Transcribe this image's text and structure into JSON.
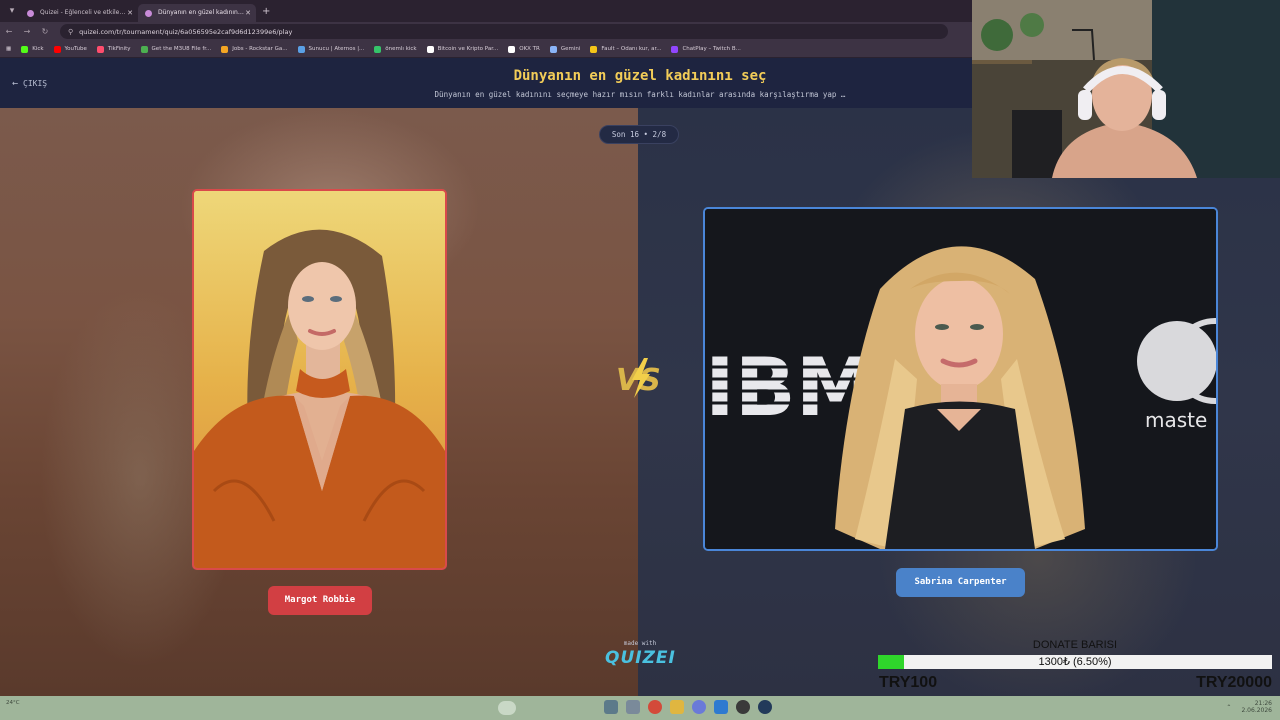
{
  "browser": {
    "tabs": [
      {
        "label": "Quizei - Eğlenceli ve etkileşimli",
        "active": false
      },
      {
        "label": "Dünyanın en güzel kadınını seç",
        "active": true
      }
    ],
    "url": "quizei.com/tr/tournament/quiz/6a056595e2caf9d6d12399e6/play",
    "bookmarks": [
      {
        "label": "Kick",
        "color": "#53fc18"
      },
      {
        "label": "YouTube",
        "color": "#ff0000"
      },
      {
        "label": "TikFinity",
        "color": "#ff4d6d"
      },
      {
        "label": "Get the M3U8 File fr...",
        "color": "#4caf50"
      },
      {
        "label": "Jobs - Rockstar Ga...",
        "color": "#f5a623"
      },
      {
        "label": "Sunucu | Aternos |...",
        "color": "#5aa0e6"
      },
      {
        "label": "önemlı kick",
        "color": "#35c46a"
      },
      {
        "label": "Bitcoin ve Kripto Par...",
        "color": "#ffffff"
      },
      {
        "label": "OKX TR",
        "color": "#ffffff"
      },
      {
        "label": "Gemini",
        "color": "#8ab4f8"
      },
      {
        "label": "Fault – Odanı kur, ar...",
        "color": "#f5c518"
      },
      {
        "label": "ChatPlay – Twitch B...",
        "color": "#9146ff"
      }
    ]
  },
  "header": {
    "exit_label": "ÇIKIŞ",
    "title": "Dünyanın en güzel kadınını seç",
    "description": "Dünyanın en güzel kadınını seçmeye hazır mısın farklı kadınlar arasında karşılaştırma yap …"
  },
  "round": {
    "label": "Son 16 • 2/8"
  },
  "contestants": {
    "left": {
      "name": "Margot Robbie",
      "color": "#d23f43"
    },
    "right": {
      "name": "Sabrina Carpenter",
      "color": "#4a82c9"
    }
  },
  "vs_label": "VS",
  "background_texts": {
    "ibm": "IBM",
    "master": "maste"
  },
  "footer": {
    "made_with": "made with",
    "logo": "QUIZEI"
  },
  "donate": {
    "title": "DONATE BARISI",
    "progress_text": "1300₺ (6.50%)",
    "progress_fraction": 0.065,
    "min": "TRY100",
    "max": "TRY20000"
  },
  "taskbar": {
    "time": "21:26",
    "date": "2.06.2026",
    "weather": "24°C"
  }
}
